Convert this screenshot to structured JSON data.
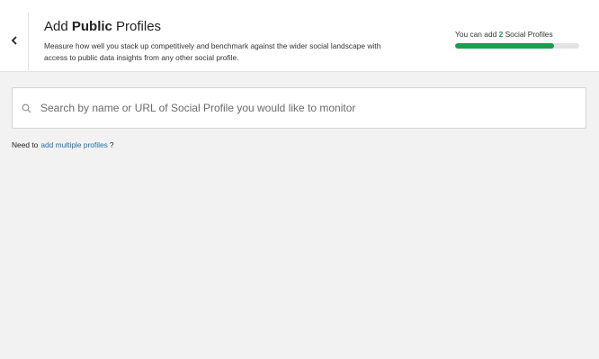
{
  "header": {
    "title_prefix": "Add ",
    "title_bold": "Public",
    "title_suffix": " Profiles",
    "description": "Measure how well you stack up competitively and benchmark against the wider social landscape with access to public data insights from any other social profile.",
    "limit": {
      "prefix": "You can add ",
      "count": "2",
      "suffix": " Social Profiles",
      "progress_fraction": 0.8
    }
  },
  "search": {
    "placeholder": "Search by name or URL of Social Profile you would like to monitor",
    "value": ""
  },
  "multi": {
    "prefix": "Need to",
    "link": "add multiple profiles",
    "suffix": "?"
  },
  "icons": {
    "back": "chevron-left-icon",
    "search": "search-icon"
  },
  "colors": {
    "accent_green": "#1a9e50",
    "link_blue": "#1d6fa8"
  }
}
